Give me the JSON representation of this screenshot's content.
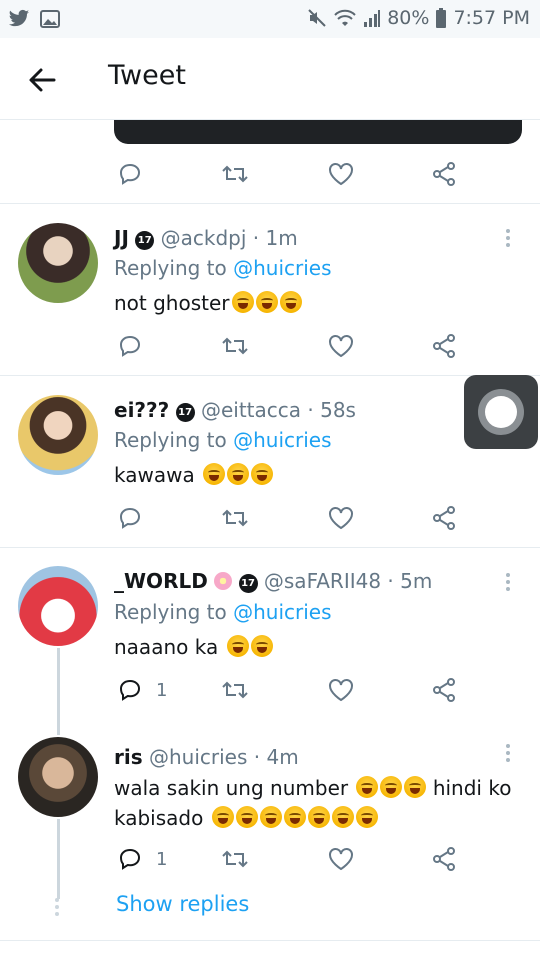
{
  "status_bar": {
    "battery": "80%",
    "time": "7:57 PM"
  },
  "header": {
    "title": "Tweet"
  },
  "replies": [
    {
      "name": "JJ",
      "badge": "17",
      "handle": "@ackdpj",
      "time": "1m",
      "replying_prefix": "Replying to",
      "mention": "@huicries",
      "text": "not ghoster",
      "emoji_count": 3,
      "reply_count": ""
    },
    {
      "name": "ei???",
      "badge": "17",
      "handle": "@eittacca",
      "time": "58s",
      "replying_prefix": "Replying to",
      "mention": "@huicries",
      "text": "kawawa",
      "emoji_count": 3,
      "reply_count": ""
    },
    {
      "name": "_WORLD",
      "badge": "17",
      "handle": "@saFARII48",
      "time": "5m",
      "replying_prefix": "Replying to",
      "mention": "@huicries",
      "text": "naaano ka",
      "emoji_count": 2,
      "reply_count": "1"
    },
    {
      "name": "ris",
      "handle": "@huicries",
      "time": "4m",
      "text_line1": "wala sakin ung number",
      "text_line1_suffix": "hindi ko",
      "text_line2": "kabisado",
      "emoji_count_line1": 3,
      "emoji_count_line2": 7,
      "reply_count": "1"
    }
  ],
  "show_replies_label": "Show replies",
  "icons": {
    "status_left": [
      "twitter-icon",
      "image-icon"
    ],
    "status_right": [
      "mute-icon",
      "wifi-icon",
      "signal-icon",
      "battery-icon"
    ],
    "actions": [
      "reply-icon",
      "retweet-icon",
      "like-icon",
      "share-icon"
    ]
  },
  "colors": {
    "accent": "#1da1f2",
    "secondary_text": "#657786",
    "divider": "#e6ecf0"
  }
}
